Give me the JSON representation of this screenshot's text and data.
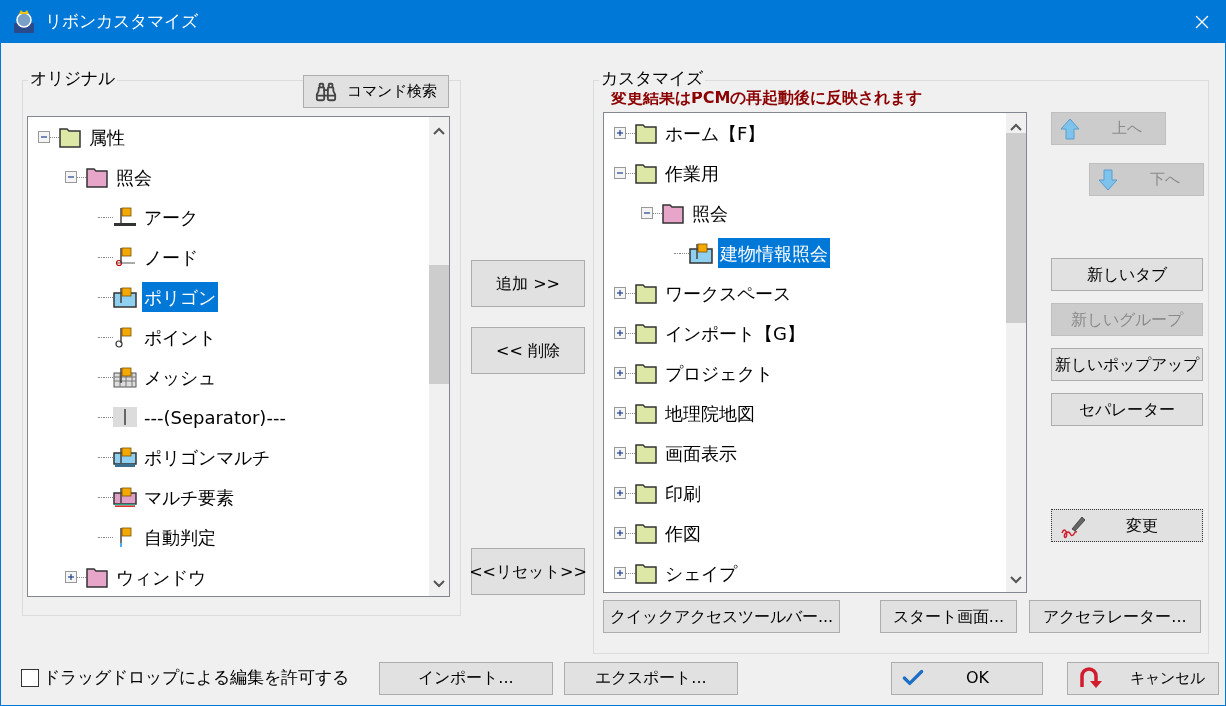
{
  "window": {
    "title": "リボンカスタマイズ"
  },
  "original": {
    "title": "オリジナル",
    "search_button": "コマンド検索",
    "tree": [
      {
        "label": "属性",
        "kind": "tab",
        "expanded": true,
        "selected": false,
        "children": [
          {
            "label": "照会",
            "kind": "group",
            "expanded": true,
            "selected": false,
            "children": [
              {
                "label": "アーク",
                "kind": "arc",
                "selected": false
              },
              {
                "label": "ノード",
                "kind": "node",
                "selected": false
              },
              {
                "label": "ポリゴン",
                "kind": "polygon",
                "selected": true
              },
              {
                "label": "ポイント",
                "kind": "point",
                "selected": false
              },
              {
                "label": "メッシュ",
                "kind": "mesh",
                "selected": false
              },
              {
                "label": "---(Separator)---",
                "kind": "separator",
                "selected": false
              },
              {
                "label": "ポリゴンマルチ",
                "kind": "multipolygon",
                "selected": false
              },
              {
                "label": "マルチ要素",
                "kind": "multi",
                "selected": false
              },
              {
                "label": "自動判定",
                "kind": "auto",
                "selected": false
              }
            ]
          },
          {
            "label": "ウィンドウ",
            "kind": "group",
            "expanded": false,
            "selected": false
          }
        ]
      }
    ]
  },
  "middle_buttons": [
    {
      "label": "追加 >>"
    },
    {
      "label": "<< 削除"
    },
    {
      "label": "<<リセット>>"
    }
  ],
  "customize": {
    "title": "カスタマイズ",
    "notice": "変更結果はPCMの再起動後に反映されます",
    "tree": [
      {
        "label": "ホーム【F】",
        "kind": "tab",
        "expanded": false,
        "selected": false
      },
      {
        "label": "作業用",
        "kind": "tab",
        "expanded": true,
        "selected": false,
        "children": [
          {
            "label": "照会",
            "kind": "group",
            "expanded": true,
            "selected": false,
            "children": [
              {
                "label": "建物情報照会",
                "kind": "polygon",
                "selected": true
              }
            ]
          }
        ]
      },
      {
        "label": "ワークスペース",
        "kind": "tab",
        "expanded": false,
        "selected": false
      },
      {
        "label": "インポート【G】",
        "kind": "tab",
        "expanded": false,
        "selected": false
      },
      {
        "label": "プロジェクト",
        "kind": "tab",
        "expanded": false,
        "selected": false
      },
      {
        "label": "地理院地図",
        "kind": "tab",
        "expanded": false,
        "selected": false
      },
      {
        "label": "画面表示",
        "kind": "tab",
        "expanded": false,
        "selected": false
      },
      {
        "label": "印刷",
        "kind": "tab",
        "expanded": false,
        "selected": false
      },
      {
        "label": "作図",
        "kind": "tab",
        "expanded": false,
        "selected": false
      },
      {
        "label": "シェイプ",
        "kind": "tab",
        "expanded": false,
        "selected": false
      }
    ],
    "move_buttons": [
      {
        "label": "上へ",
        "kind": "up",
        "disabled": true
      },
      {
        "label": "下へ",
        "kind": "down",
        "disabled": true
      }
    ],
    "new_buttons": [
      {
        "label": "新しいタブ",
        "disabled": false
      },
      {
        "label": "新しいグループ",
        "disabled": true
      },
      {
        "label": "新しいポップアップ",
        "disabled": false
      },
      {
        "label": "セパレーター",
        "disabled": false
      }
    ],
    "edit_button": {
      "label": "変更",
      "focused": true
    },
    "bottom_buttons": [
      "クイックアクセスツールバー...",
      "スタート画面...",
      "アクセラレーター..."
    ]
  },
  "footer": {
    "checkbox": {
      "label": "ドラッグドロップによる編集を許可する",
      "checked": false
    },
    "buttons": [
      {
        "label": "インポート...",
        "kind": "plain"
      },
      {
        "label": "エクスポート...",
        "kind": "plain"
      },
      {
        "label": "OK",
        "kind": "ok"
      },
      {
        "label": "キャンセル",
        "kind": "cancel"
      }
    ]
  }
}
